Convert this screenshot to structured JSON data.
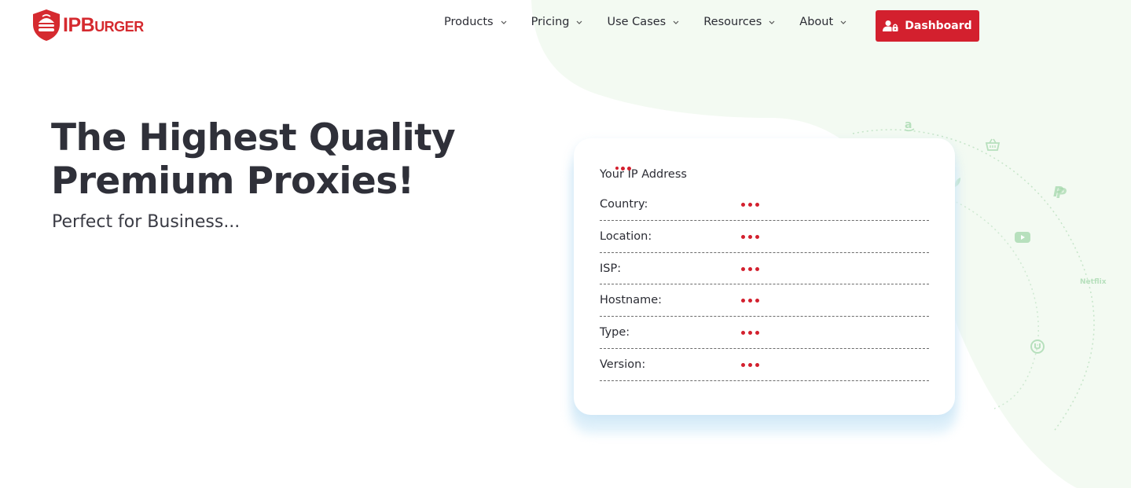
{
  "brand": {
    "logo_text_big1": "IP",
    "logo_text_big2": "B",
    "logo_text_small": "URGER",
    "accent_color": "#d3202e"
  },
  "nav": {
    "items": [
      {
        "label": "Products"
      },
      {
        "label": "Pricing"
      },
      {
        "label": "Use Cases"
      },
      {
        "label": "Resources"
      },
      {
        "label": "About"
      }
    ],
    "dashboard_label": "Dashboard"
  },
  "hero": {
    "title_line1": "The Highest Quality",
    "title_line2": "Premium Proxies!",
    "subtitle": "Perfect for Business..."
  },
  "ip_card": {
    "title": "Your IP Address",
    "rows": [
      {
        "label": "Country:"
      },
      {
        "label": "Location:"
      },
      {
        "label": "ISP:"
      },
      {
        "label": "Hostname:"
      },
      {
        "label": "Type:"
      },
      {
        "label": "Version:"
      }
    ]
  },
  "orbit": {
    "netflix_label": "Netflix",
    "icons": [
      "amazon-icon",
      "basket-icon",
      "paypal-icon",
      "youtube-icon",
      "utorrent-icon",
      "leaf-icon"
    ]
  }
}
